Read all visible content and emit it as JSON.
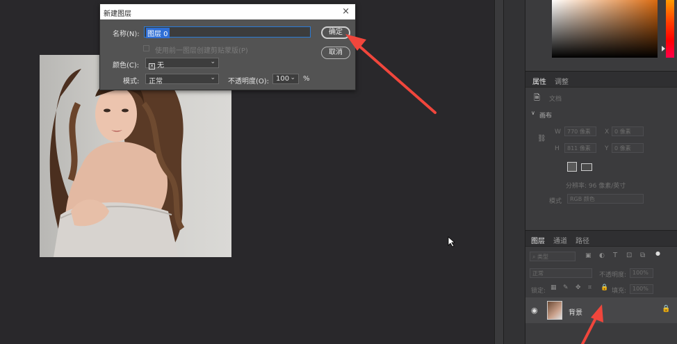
{
  "dialog": {
    "title": "新建图层",
    "name_label": "名称(N):",
    "name_value": "图层 0",
    "clip_label": "使用前一图层创建剪贴蒙版(P)",
    "color_label": "颜色(C):",
    "color_value": "无",
    "mode_label": "模式:",
    "mode_value": "正常",
    "opacity_label": "不透明度(O):",
    "opacity_value": "100",
    "opacity_unit": "%",
    "ok_label": "确定",
    "cancel_label": "取消"
  },
  "properties_panel": {
    "tabs": [
      "属性",
      "调整"
    ],
    "doc_label": "文档",
    "canvas_section": "画布",
    "w_label": "W",
    "w_value": "770 像素",
    "h_label": "H",
    "h_value": "811 像素",
    "x_label": "X",
    "x_value": "0 像素",
    "y_label": "Y",
    "y_value": "0 像素",
    "resolution": "分辨率: 96 像素/英寸",
    "mode_label": "模式",
    "mode_value": "RGB 颜色"
  },
  "layers_panel": {
    "tabs": [
      "图层",
      "通道",
      "路径"
    ],
    "filter_label": "类型",
    "blend_mode": "正常",
    "opacity_label": "不透明度:",
    "opacity_value": "100%",
    "lock_label": "锁定:",
    "fill_label": "填充:",
    "fill_value": "100%",
    "layer_name": "背景"
  },
  "colors": {
    "arrow": "#f0463c",
    "selection": "#2f6fd6"
  }
}
